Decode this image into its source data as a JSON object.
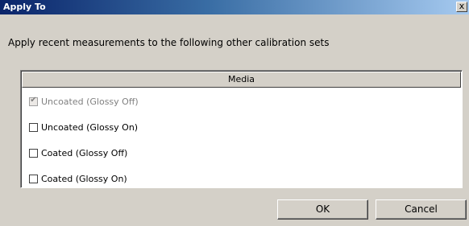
{
  "window": {
    "title": "Apply To",
    "close_glyph": "x"
  },
  "prompt": "Apply recent measurements to the following other calibration sets",
  "table": {
    "column_header": "Media",
    "rows": [
      {
        "label": "Uncoated (Glossy Off)",
        "checked": true,
        "enabled": false
      },
      {
        "label": "Uncoated (Glossy On)",
        "checked": false,
        "enabled": true
      },
      {
        "label": "Coated (Glossy Off)",
        "checked": false,
        "enabled": true
      },
      {
        "label": "Coated (Glossy On)",
        "checked": false,
        "enabled": true
      }
    ]
  },
  "buttons": {
    "ok": "OK",
    "cancel": "Cancel"
  }
}
